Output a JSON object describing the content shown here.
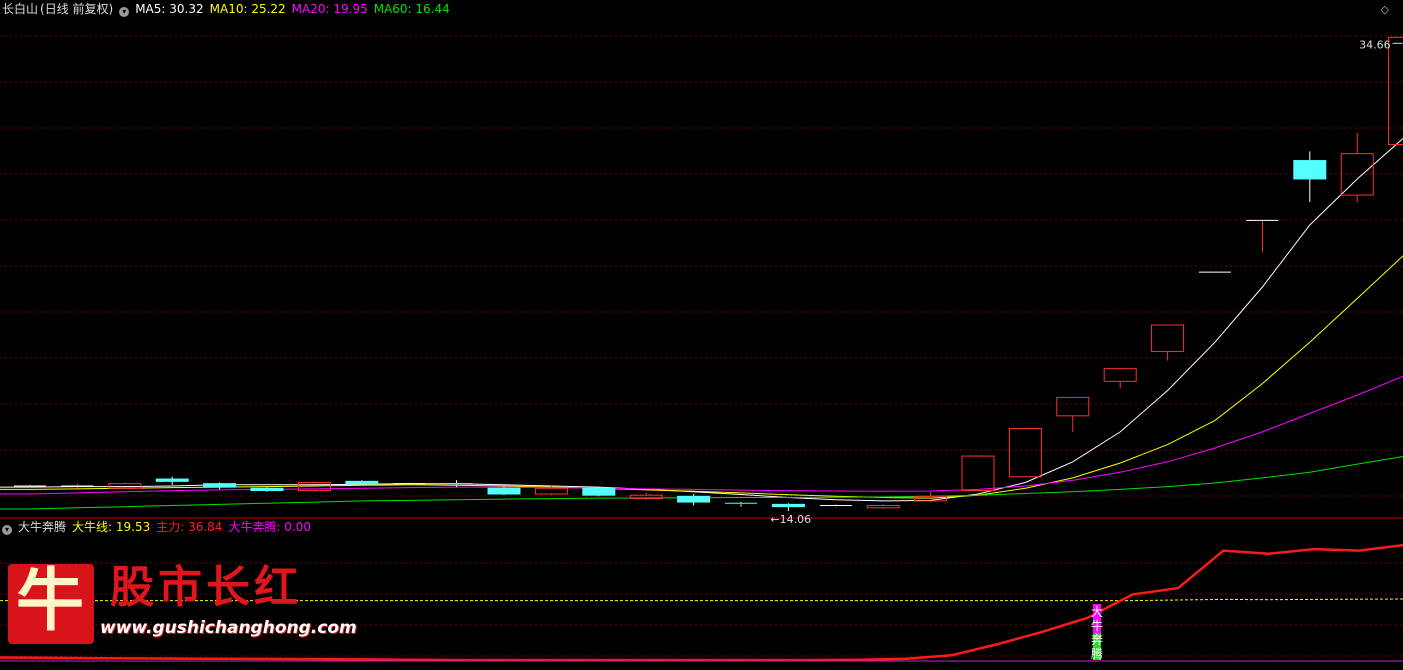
{
  "main_header": {
    "stock": "长白山",
    "mode": "(日线 前复权)",
    "indicators": [
      {
        "label": "MA5: 30.32",
        "color": "#ffffff"
      },
      {
        "label": "MA10: 25.22",
        "color": "#ffff00"
      },
      {
        "label": "MA20: 19.95",
        "color": "#ff00ff"
      },
      {
        "label": "MA60: 16.44",
        "color": "#00e000"
      }
    ]
  },
  "sub_header": {
    "name": "大牛奔腾",
    "indicators": [
      {
        "label": "大牛线: 19.53",
        "color": "#ffff00"
      },
      {
        "label": "主力: 36.84",
        "color": "#ff2020"
      },
      {
        "label": "大牛奔腾: 0.00",
        "color": "#ff00ff"
      }
    ]
  },
  "annotations": {
    "high_label": "34.66",
    "low_label": "←14.06",
    "signal_text": [
      "大",
      "牛",
      "奔",
      "腾"
    ]
  },
  "logo": {
    "glyph": "牛",
    "title": "股市长红",
    "url": "www.gushichanghong.com"
  },
  "colors": {
    "up": "#ff3030",
    "down": "#54ffff",
    "grid": "#7a0000",
    "ma5": "#ffffff",
    "ma10": "#ffff00",
    "ma20": "#ff00ff",
    "ma60": "#00e000"
  },
  "chart_data": [
    {
      "type": "candlestick",
      "title": "长白山 (日线 前复权)",
      "ylim": [
        13.8,
        35.5
      ],
      "series_ma": {
        "MA5": [
          15.1,
          15.12,
          15.12,
          15.15,
          15.2,
          15.2,
          15.2,
          15.22,
          15.25,
          15.25,
          15.2,
          15.15,
          15.1,
          15.0,
          14.9,
          14.78,
          14.65,
          14.55,
          14.5,
          14.52,
          14.8,
          15.3,
          16.2,
          17.5,
          19.3,
          21.4,
          23.8,
          26.5,
          28.5,
          30.32
        ],
        "MA10": [
          15.0,
          15.02,
          15.05,
          15.08,
          15.1,
          15.12,
          15.15,
          15.18,
          15.2,
          15.18,
          15.15,
          15.1,
          15.05,
          14.98,
          14.92,
          14.85,
          14.77,
          14.7,
          14.65,
          14.62,
          14.75,
          15.05,
          15.5,
          16.15,
          16.95,
          18.0,
          19.6,
          21.4,
          23.3,
          25.22
        ],
        "MA20": [
          14.8,
          14.85,
          14.9,
          14.95,
          14.98,
          15.0,
          15.02,
          15.05,
          15.08,
          15.1,
          15.1,
          15.08,
          15.05,
          15.02,
          15.0,
          14.97,
          14.95,
          14.93,
          14.92,
          14.93,
          15.0,
          15.15,
          15.4,
          15.75,
          16.2,
          16.8,
          17.5,
          18.3,
          19.1,
          19.95
        ],
        "MA60": [
          14.15,
          14.2,
          14.25,
          14.3,
          14.35,
          14.4,
          14.45,
          14.5,
          14.52,
          14.55,
          14.58,
          14.6,
          14.62,
          14.63,
          14.64,
          14.65,
          14.65,
          14.66,
          14.67,
          14.7,
          14.75,
          14.82,
          14.9,
          15.0,
          15.12,
          15.28,
          15.5,
          15.75,
          16.1,
          16.44
        ]
      },
      "candles": [
        {
          "o": 15.1,
          "c": 15.15,
          "h": 15.2,
          "l": 15.05
        },
        {
          "o": 15.1,
          "c": 15.15,
          "h": 15.25,
          "l": 15.05
        },
        {
          "o": 15.05,
          "c": 15.25,
          "h": 15.3,
          "l": 15.0
        },
        {
          "o": 15.45,
          "c": 15.35,
          "h": 15.55,
          "l": 15.2
        },
        {
          "o": 15.25,
          "c": 15.1,
          "h": 15.3,
          "l": 15.0
        },
        {
          "o": 15.05,
          "c": 14.95,
          "h": 15.1,
          "l": 14.9
        },
        {
          "o": 14.95,
          "c": 15.3,
          "h": 15.35,
          "l": 14.9
        },
        {
          "o": 15.35,
          "c": 15.25,
          "h": 15.4,
          "l": 15.2
        },
        {
          "o": 15.2,
          "c": 15.25,
          "h": 15.3,
          "l": 15.15
        },
        {
          "o": 15.25,
          "c": 15.2,
          "h": 15.4,
          "l": 15.1
        },
        {
          "o": 15.05,
          "c": 14.8,
          "h": 15.1,
          "l": 14.75
        },
        {
          "o": 14.8,
          "c": 15.05,
          "h": 15.15,
          "l": 14.75
        },
        {
          "o": 15.05,
          "c": 14.75,
          "h": 15.1,
          "l": 14.7
        },
        {
          "o": 14.6,
          "c": 14.75,
          "h": 14.85,
          "l": 14.55
        },
        {
          "o": 14.7,
          "c": 14.45,
          "h": 14.8,
          "l": 14.3
        },
        {
          "o": 14.4,
          "c": 14.35,
          "h": 14.45,
          "l": 14.25
        },
        {
          "o": 14.35,
          "c": 14.25,
          "h": 14.4,
          "l": 14.06
        },
        {
          "o": 14.25,
          "c": 14.3,
          "h": 14.35,
          "l": 14.2
        },
        {
          "o": 14.2,
          "c": 14.3,
          "h": 14.35,
          "l": 14.15
        },
        {
          "o": 14.5,
          "c": 14.7,
          "h": 14.9,
          "l": 14.45
        },
        {
          "o": 14.95,
          "c": 16.45,
          "h": 16.45,
          "l": 14.95
        },
        {
          "o": 15.55,
          "c": 17.65,
          "h": 17.65,
          "l": 15.55
        },
        {
          "o": 18.2,
          "c": 19.0,
          "h": 19.0,
          "l": 17.5
        },
        {
          "o": 19.7,
          "c": 20.25,
          "h": 20.25,
          "l": 19.4
        },
        {
          "o": 21.0,
          "c": 22.15,
          "h": 22.15,
          "l": 20.6
        },
        {
          "o": 24.45,
          "c": 24.45,
          "h": 24.45,
          "l": 24.45
        },
        {
          "o": 26.7,
          "c": 26.7,
          "h": 26.7,
          "l": 25.3
        },
        {
          "o": 29.3,
          "c": 28.5,
          "h": 29.7,
          "l": 27.5
        },
        {
          "o": 27.8,
          "c": 29.6,
          "h": 30.5,
          "l": 27.5
        },
        {
          "o": 30.0,
          "c": 34.66,
          "h": 34.66,
          "l": 29.6
        }
      ]
    },
    {
      "type": "line",
      "title": "大牛奔腾",
      "ylim": [
        0,
        40
      ],
      "series": [
        {
          "name": "主力",
          "values": [
            0.8,
            0.7,
            0.6,
            0.5,
            0.45,
            0.4,
            0.35,
            0.3,
            0.2,
            0.1,
            0.0,
            0.0,
            0.0,
            0.0,
            0.0,
            0.0,
            0.0,
            0.0,
            0.0,
            0.1,
            0.4,
            1.5,
            5.0,
            9.0,
            13.5,
            21.0,
            23.0,
            35.0,
            34.0,
            35.5,
            35.0,
            36.84
          ]
        },
        {
          "name": "大牛线",
          "values": [
            19.0,
            19.0,
            19.0,
            19.0,
            19.0,
            19.0,
            19.0,
            19.0,
            19.0,
            19.0,
            19.0,
            19.0,
            19.0,
            19.0,
            19.0,
            19.0,
            19.0,
            19.0,
            19.0,
            19.0,
            19.0,
            19.0,
            19.0,
            19.0,
            19.0,
            19.0,
            19.2,
            19.4,
            19.3,
            19.4,
            19.45,
            19.53
          ]
        }
      ]
    }
  ]
}
